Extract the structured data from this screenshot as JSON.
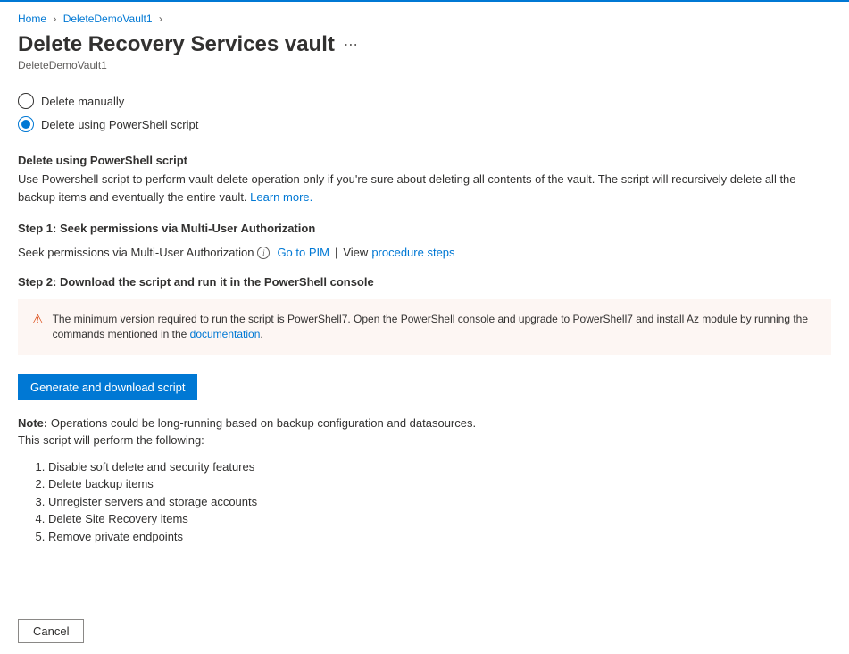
{
  "breadcrumb": {
    "home": "Home",
    "vault": "DeleteDemoVault1"
  },
  "header": {
    "title": "Delete Recovery Services vault",
    "subtitle": "DeleteDemoVault1"
  },
  "radio": {
    "manual": "Delete manually",
    "powershell": "Delete using PowerShell script"
  },
  "section": {
    "heading": "Delete using PowerShell script",
    "desc_pre": "Use Powershell script to perform vault delete operation only if you're sure about deleting all contents of the vault. The script will recursively delete all the backup items and eventually the entire vault. ",
    "learn_more": "Learn more."
  },
  "step1": {
    "heading": "Step 1: Seek permissions via Multi-User Authorization",
    "text": "Seek permissions via Multi-User Authorization",
    "goto_pim": "Go to PIM",
    "view": "View ",
    "procedure_steps": "procedure steps"
  },
  "step2": {
    "heading": "Step 2: Download the script and run it in the PowerShell console"
  },
  "warning": {
    "text_pre": "The minimum version required to run the script is PowerShell7. Open the PowerShell console and upgrade to PowerShell7 and install Az module by running the commands mentioned in the ",
    "doc_link": "documentation",
    "text_post": "."
  },
  "button": {
    "generate": "Generate and download script",
    "cancel": "Cancel"
  },
  "note": {
    "label": "Note:",
    "text": " Operations could be long-running based on backup configuration and datasources.",
    "followup": "This script will perform the following:"
  },
  "list": {
    "item1": "Disable soft delete and security features",
    "item2": "Delete backup items",
    "item3": "Unregister servers and storage accounts",
    "item4": "Delete Site Recovery items",
    "item5": "Remove private endpoints"
  }
}
